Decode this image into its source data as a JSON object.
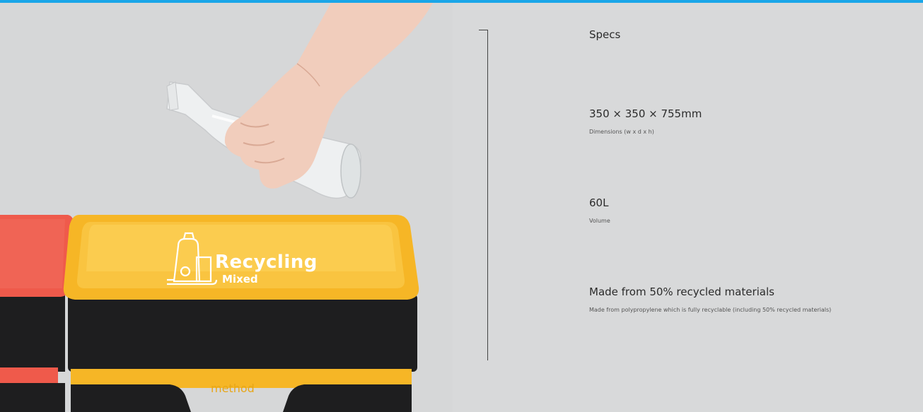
{
  "photo": {
    "bin_label_main": "Recycling",
    "bin_label_sub": "Mixed",
    "brand_mark": "method"
  },
  "specs": {
    "title": "Specs",
    "items": [
      {
        "value": "350 × 350 × 755mm",
        "label": "Dimensions (w x d x h)"
      },
      {
        "value": "60L",
        "label": "Volume"
      },
      {
        "value": "Made from 50% recycled materials",
        "label": "Made from polypropylene which is fully recyclable (including 50% recycled materials)"
      }
    ]
  },
  "colors": {
    "accent_bar": "#1aa6e8",
    "bin_yellow": "#f6b626",
    "bin_red": "#ef5a4b",
    "bin_black": "#1e1e1f",
    "background": "#d8d9da"
  }
}
